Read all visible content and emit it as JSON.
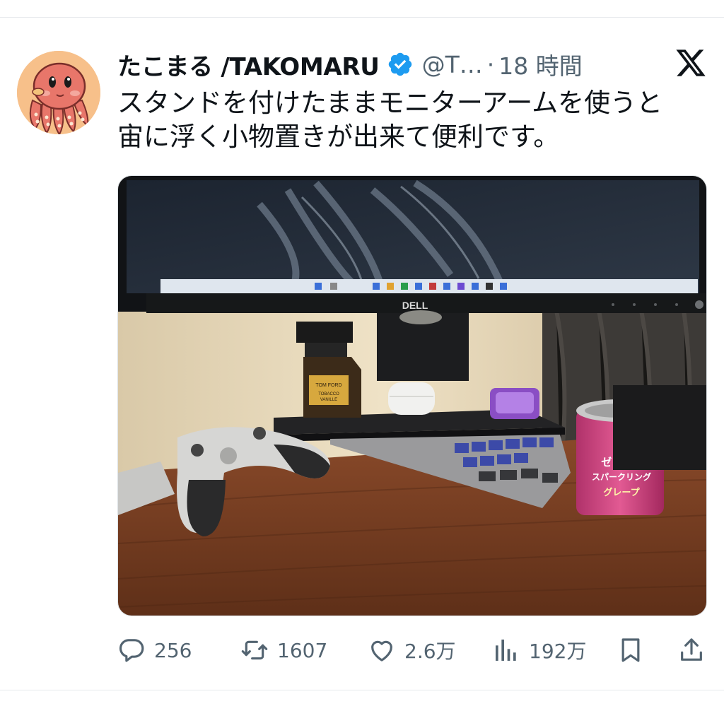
{
  "tweet": {
    "display_name": "たこまる /TAKOMARU",
    "handle": "@T…",
    "separator": "·",
    "time": "18 時間",
    "text_lines": [
      "スタンドを付けたままモニターアームを使うと",
      "宙に浮く小物置きが出来て便利です。"
    ]
  },
  "photo": {
    "monitor_brand": "DELL",
    "perfume_brand": "TOM FORD",
    "perfume_name_line1": "TOBACCO",
    "perfume_name_line2": "VANILLE",
    "can_label_line1": "ゼリー×",
    "can_label_line2": "スパークリング",
    "can_label_line3": "グレープ"
  },
  "actions": {
    "reply_count": "256",
    "retweet_count": "1607",
    "like_count": "2.6万",
    "views_count": "192万"
  },
  "icons": {
    "verified": "verified-badge-icon",
    "x": "x-logo-icon",
    "reply": "reply-icon",
    "retweet": "retweet-icon",
    "like": "heart-icon",
    "views": "views-chart-icon",
    "bookmark": "bookmark-icon",
    "share": "share-icon"
  },
  "colors": {
    "verified_blue": "#1d9bf0",
    "secondary_text": "#536471"
  }
}
